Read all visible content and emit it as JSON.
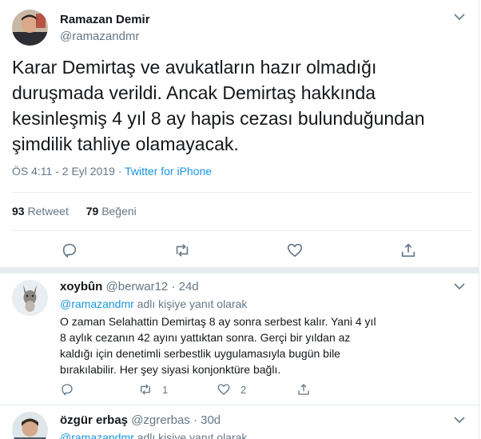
{
  "main_tweet": {
    "author_name": "Ramazan Demir",
    "author_handle": "@ramazandmr",
    "text": "Karar Demirtaş ve avukatların hazır olmadığı duruşmada verildi. Ancak Demirtaş hakkında kesinleşmiş 4 yıl 8 ay hapis cezası bulunduğundan şimdilik tahliye olamayacak.",
    "time": "ÖS 4:11 - 2 Eyl 2019",
    "dot": "·",
    "source": "Twitter for iPhone",
    "retweets_count": "93",
    "retweets_label": "Retweet",
    "likes_count": "79",
    "likes_label": "Beğeni"
  },
  "replies": [
    {
      "name": "xoybûn",
      "handle": "@berwar12 · 24d",
      "mention": "@ramazandmr",
      "replying_suffix": " adlı kişiye yanıt olarak",
      "text": "O zaman Selahattin Demirtaş 8 ay sonra serbest kalır. Yani 4 yıl 8 aylık cezanın 42 ayını yattıktan sonra. Gerçi bir yıldan az kaldığı için denetimli serbestlik uygulamasıyla bugün bile bırakılabilir. Her şey siyasi konjonktüre bağlı.",
      "reply_count": "",
      "retweet_count": "1",
      "like_count": "2"
    },
    {
      "name": "özgür erbaş",
      "handle": "@zgrerbas · 30d",
      "mention": "@ramazandmr",
      "replying_suffix": " adlı kişiye yanıt olarak"
    }
  ],
  "colors": {
    "accent": "#1b95e0",
    "muted": "#657786",
    "text": "#14171a",
    "divider": "#e6ecf0"
  }
}
